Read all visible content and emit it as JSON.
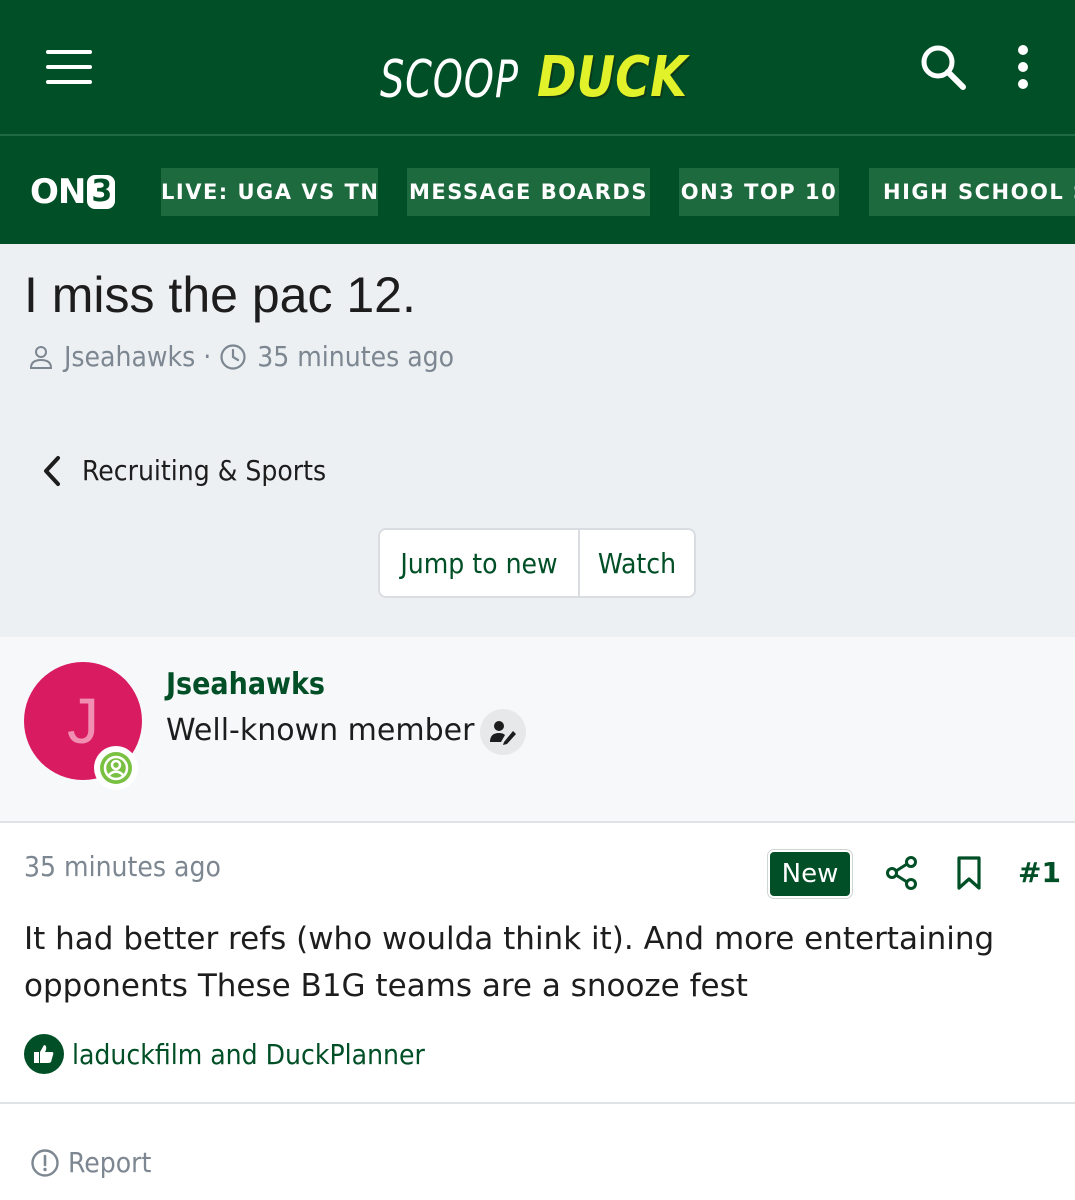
{
  "header": {
    "logo_left": "SCOOP",
    "logo_right": "DUCK",
    "menu_icon": "hamburger-menu-icon",
    "search_icon": "search-icon",
    "more_icon": "vertical-ellipsis-icon"
  },
  "nav": {
    "brand_left": "ON",
    "brand_right": "3",
    "items": [
      {
        "label": "LIVE: UGA VS TN"
      },
      {
        "label": "MESSAGE BOARDS"
      },
      {
        "label": "ON3 TOP 10"
      },
      {
        "label": "HIGH SCHOOL SCORES"
      }
    ]
  },
  "thread": {
    "title": "I miss the pac 12.",
    "author": "Jseahawks",
    "separator": "·",
    "time": "35 minutes ago",
    "forum": "Recruiting & Sports",
    "jump_label": "Jump to new",
    "watch_label": "Watch"
  },
  "post": {
    "author_name": "Jseahawks",
    "author_initial": "J",
    "author_role": "Well-known member",
    "time": "35 minutes ago",
    "badge": "New",
    "number": "#1",
    "body": "It had better refs (who woulda think it). And more entertaining opponents These B1G teams are a snooze fest",
    "reactions": "laduckfilm and DuckPlanner",
    "report_label": "Report"
  },
  "colors": {
    "brand_green": "#004f26",
    "nav_pill": "#1e6a3f",
    "accent_yellow": "#e1f22a",
    "avatar_pink": "#d91b62",
    "online_green": "#7ac143",
    "muted_text": "#7d8791"
  }
}
